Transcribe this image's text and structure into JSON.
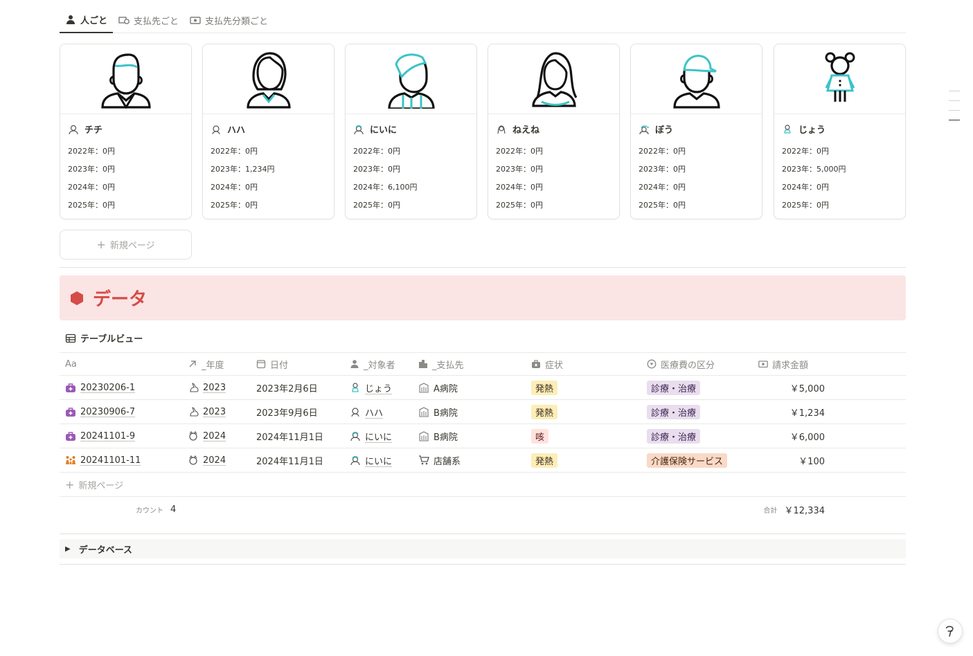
{
  "tabs": [
    {
      "label": "人ごと",
      "icon": "person-icon",
      "active": true
    },
    {
      "label": "支払先ごと",
      "icon": "payee-icon",
      "active": false
    },
    {
      "label": "支払先分類ごと",
      "icon": "money-icon",
      "active": false
    }
  ],
  "people": [
    {
      "name": "チチ",
      "y2022": "2022年：0円",
      "y2023": "2023年：0円",
      "y2024": "2024年：0円",
      "y2025": "2025年：0円",
      "avatar": "man-icon"
    },
    {
      "name": "ハハ",
      "y2022": "2022年：0円",
      "y2023": "2023年：1,234円",
      "y2024": "2024年：0円",
      "y2025": "2025年：0円",
      "avatar": "woman-icon"
    },
    {
      "name": "にいに",
      "y2022": "2022年：0円",
      "y2023": "2023年：0円",
      "y2024": "2024年：6,100円",
      "y2025": "2025年：0円",
      "avatar": "boy-icon"
    },
    {
      "name": "ねえね",
      "y2022": "2022年：0円",
      "y2023": "2023年：0円",
      "y2024": "2024年：0円",
      "y2025": "2025年：0円",
      "avatar": "girl-icon"
    },
    {
      "name": "ぼう",
      "y2022": "2022年：0円",
      "y2023": "2023年：0円",
      "y2024": "2024年：0円",
      "y2025": "2025年：0円",
      "avatar": "cap-boy-icon"
    },
    {
      "name": "じょう",
      "y2022": "2022年：0円",
      "y2023": "2023年：5,000円",
      "y2024": "2024年：0円",
      "y2025": "2025年：0円",
      "avatar": "child-icon"
    }
  ],
  "gallery": {
    "new_page": "新規ページ"
  },
  "section": {
    "title": "データ",
    "color": "#d44c47"
  },
  "view": {
    "label": "テーブルビュー"
  },
  "table": {
    "headers": {
      "name": "Aa",
      "year": "_年度",
      "date": "日付",
      "person": "_対象者",
      "payee": "_支払先",
      "symptom": "症状",
      "category": "医療費の区分",
      "amount": "請求金額"
    },
    "rows": [
      {
        "id": "20230206-1",
        "year": "2023",
        "date": "2023年2月6日",
        "person": "じょう",
        "payee": "A病院",
        "symptom": "発熱",
        "symptom_color": "yellow",
        "category": "診療・治療",
        "category_color": "purple",
        "amount": "￥5,000"
      },
      {
        "id": "20230906-7",
        "year": "2023",
        "date": "2023年9月6日",
        "person": "ハハ",
        "payee": "B病院",
        "symptom": "発熱",
        "symptom_color": "yellow",
        "category": "診療・治療",
        "category_color": "purple",
        "amount": "￥1,234"
      },
      {
        "id": "20241101-9",
        "year": "2024",
        "date": "2024年11月1日",
        "person": "にいに",
        "payee": "B病院",
        "symptom": "咳",
        "symptom_color": "red",
        "category": "診療・治療",
        "category_color": "purple",
        "amount": "￥6,000"
      },
      {
        "id": "20241101-11",
        "year": "2024",
        "date": "2024年11月1日",
        "person": "にいに",
        "payee": "店舗系",
        "symptom": "発熱",
        "symptom_color": "yellow",
        "category": "介護保険サービス",
        "category_color": "orange",
        "amount": "￥100"
      }
    ],
    "new_page": "新規ページ",
    "count_label": "カウント",
    "count_value": "4",
    "sum_label": "合計",
    "sum_value": "￥12,334"
  },
  "toggle": {
    "label": "データベース"
  },
  "help": {
    "label": "?"
  }
}
